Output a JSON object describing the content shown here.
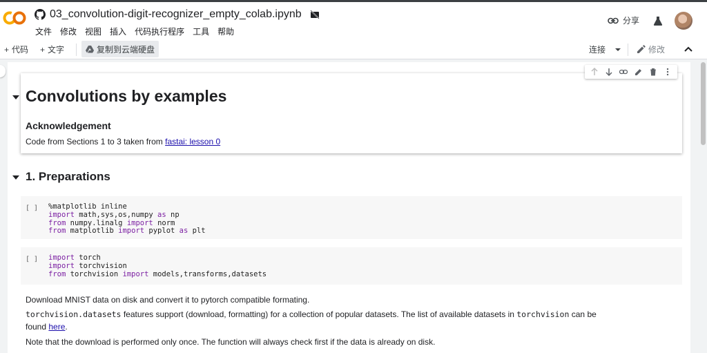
{
  "header": {
    "title": "03_convolution-digit-recognizer_empty_colab.ipynb",
    "menu": [
      "文件",
      "修改",
      "视图",
      "插入",
      "代码执行程序",
      "工具",
      "帮助"
    ],
    "share_label": "分享"
  },
  "toolbar": {
    "add_code": "代码",
    "add_text": "文字",
    "copy_to_drive": "复制到云端硬盘",
    "connect": "连接",
    "edit": "修改"
  },
  "notebook": {
    "h1": "Convolutions by examples",
    "ack_heading": "Acknowledgement",
    "ack_text": "Code from Sections 1 to 3 taken from ",
    "ack_link": "fastai: lesson 0",
    "section1": "1. Preparations",
    "run_label": "[ ]",
    "cell1_lines": [
      [
        {
          "t": "%matplotlib inline",
          "k": false
        }
      ],
      [
        {
          "t": "import",
          "k": true
        },
        {
          "t": " math,sys,os,numpy ",
          "k": false
        },
        {
          "t": "as",
          "k": true
        },
        {
          "t": " np",
          "k": false
        }
      ],
      [
        {
          "t": "from",
          "k": true
        },
        {
          "t": " numpy.linalg ",
          "k": false
        },
        {
          "t": "import",
          "k": true
        },
        {
          "t": " norm",
          "k": false
        }
      ],
      [
        {
          "t": "from",
          "k": true
        },
        {
          "t": " matplotlib ",
          "k": false
        },
        {
          "t": "import",
          "k": true
        },
        {
          "t": " pyplot ",
          "k": false
        },
        {
          "t": "as",
          "k": true
        },
        {
          "t": " plt",
          "k": false
        }
      ]
    ],
    "cell2_lines": [
      [
        {
          "t": "import",
          "k": true
        },
        {
          "t": " torch",
          "k": false
        }
      ],
      [
        {
          "t": "import",
          "k": true
        },
        {
          "t": " torchvision",
          "k": false
        }
      ],
      [
        {
          "t": "from",
          "k": true
        },
        {
          "t": " torchvision ",
          "k": false
        },
        {
          "t": "import",
          "k": true
        },
        {
          "t": " models,transforms,datasets",
          "k": false
        }
      ]
    ],
    "p_download": "Download MNIST data on disk and convert it to pytorch compatible formating.",
    "p2_code1": "torchvision.datasets",
    "p2_text1": " features support (download, formatting) for a collection of popular datasets. The list of available datasets in ",
    "p2_code2": "torchvision",
    "p2_text2": " can be",
    "p2_text3": "found ",
    "p2_link": "here",
    "p2_text4": ".",
    "p_note": "Note that the download is performed only once. The function will always check first if the data is already on disk."
  },
  "colors": {
    "keyword": "#7b1fa2",
    "link": "#1a0dab",
    "logo_orange": "#f9ab00"
  }
}
